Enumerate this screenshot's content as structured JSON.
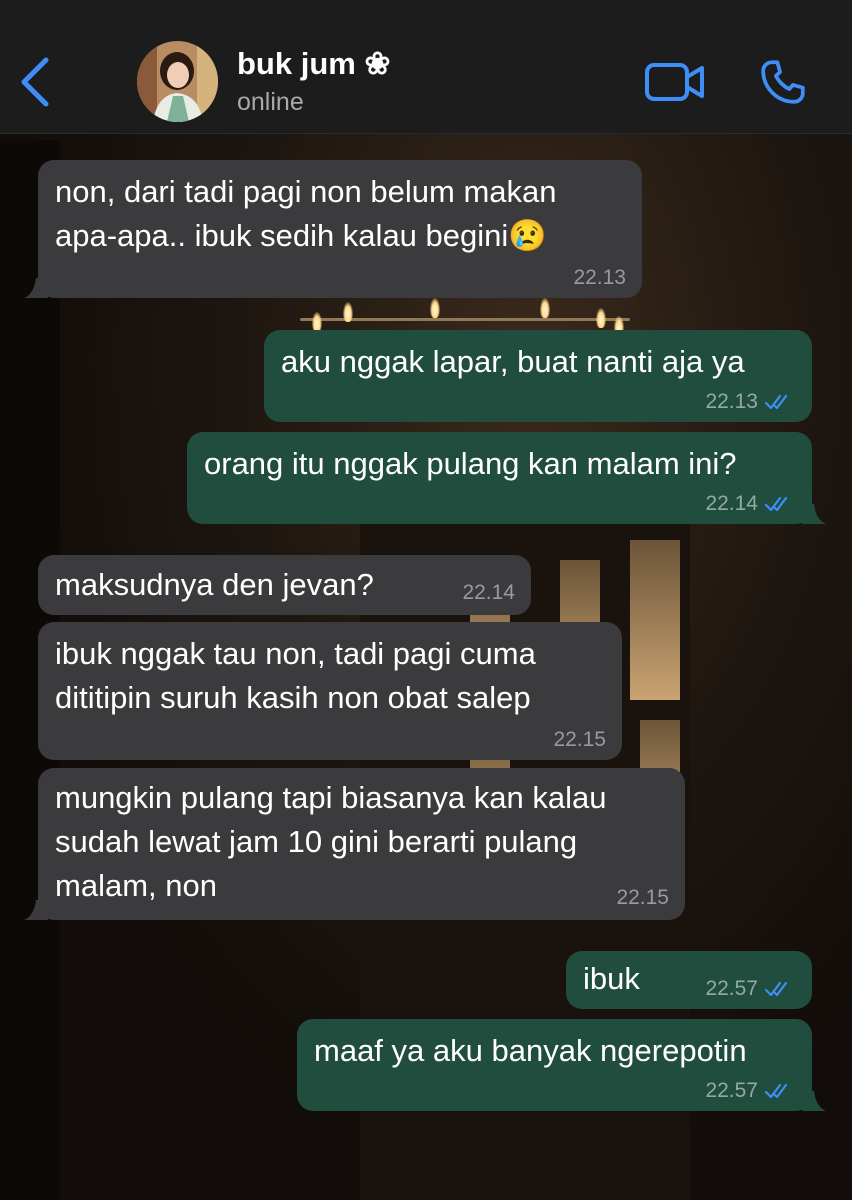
{
  "header": {
    "contact_name": "buk jum ❀",
    "status": "online"
  },
  "colors": {
    "accent": "#3d8ef7",
    "incoming_bubble": "#3b3b3d",
    "outgoing_bubble": "#204d3e",
    "header_bg": "#1c1c1d"
  },
  "messages": [
    {
      "direction": "in",
      "lines": [
        "non, dari tadi pagi non belum makan",
        "apa-apa.. ibuk sedih kalau begini😢"
      ],
      "time": "22.13"
    },
    {
      "direction": "out",
      "lines": [
        "aku nggak lapar, buat nanti aja ya"
      ],
      "time": "22.13",
      "read": true
    },
    {
      "direction": "out",
      "lines": [
        "orang itu nggak pulang kan malam ini?"
      ],
      "time": "22.14",
      "read": true
    },
    {
      "direction": "in",
      "lines": [
        "maksudnya den jevan?"
      ],
      "time": "22.14"
    },
    {
      "direction": "in",
      "lines": [
        "ibuk nggak tau non, tadi pagi cuma",
        "dititipin suruh kasih non obat salep"
      ],
      "time": "22.15"
    },
    {
      "direction": "in",
      "lines": [
        "mungkin pulang tapi biasanya kan kalau",
        "sudah lewat jam 10 gini berarti pulang",
        "malam, non"
      ],
      "time": "22.15"
    },
    {
      "direction": "out",
      "lines": [
        "ibuk"
      ],
      "time": "22.57",
      "read": true
    },
    {
      "direction": "out",
      "lines": [
        "maaf ya aku banyak ngerepotin"
      ],
      "time": "22.57",
      "read": true
    }
  ]
}
